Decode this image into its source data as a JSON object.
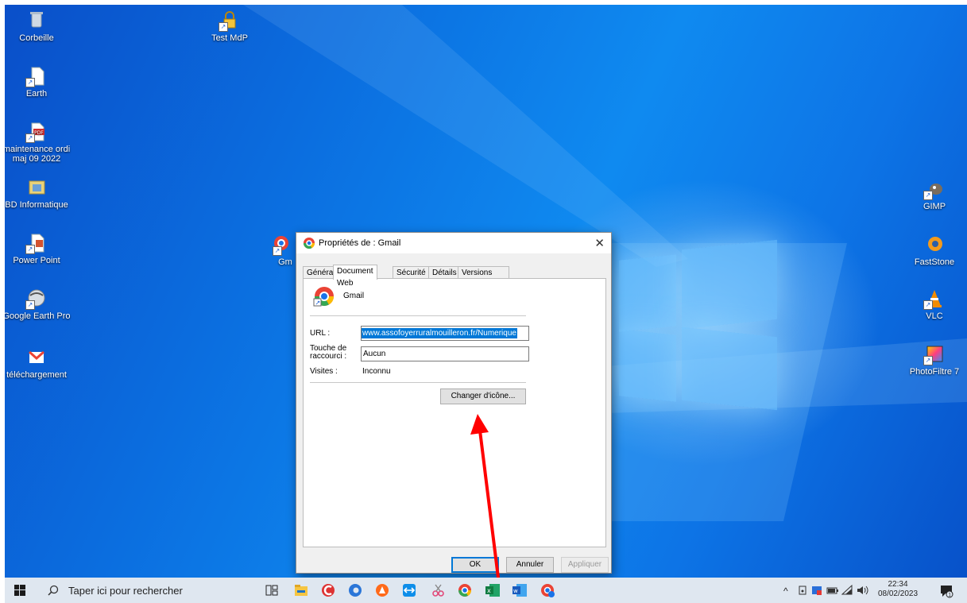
{
  "desktop": {
    "icons_left": [
      {
        "label": "Corbeille",
        "icon": "recycle-bin-icon"
      },
      {
        "label": "Earth",
        "icon": "file-shortcut-icon"
      },
      {
        "label": "maintenance ordi maj 09 2022",
        "icon": "pdf-file-icon"
      },
      {
        "label": "BD Informatique",
        "icon": "database-folder-icon"
      },
      {
        "label": "Power Point",
        "icon": "powerpoint-icon"
      },
      {
        "label": "Google Earth Pro",
        "icon": "google-earth-icon"
      },
      {
        "label": "téléchargement",
        "icon": "gmail-icon"
      }
    ],
    "icon_test": {
      "label": "Test MdP",
      "icon": "lock-icon"
    },
    "icon_partial": {
      "label": "Gm",
      "icon": "chrome-shortcut-icon"
    },
    "icons_right": [
      {
        "label": "GIMP",
        "icon": "gimp-icon"
      },
      {
        "label": "FastStone",
        "icon": "faststone-icon"
      },
      {
        "label": "VLC",
        "icon": "vlc-icon"
      },
      {
        "label": "PhotoFiltre 7",
        "icon": "photofiltre-icon"
      }
    ]
  },
  "dialog": {
    "title": "Propriétés de : Gmail",
    "close": "✕",
    "tabs": [
      "Général",
      "Document Web",
      "Sécurité",
      "Détails",
      "Versions précédentes"
    ],
    "active_tab": "Document Web",
    "name": "Gmail",
    "url_label": "URL :",
    "url_value": "www.assofoyerruralmouilleron.fr/Numerique",
    "shortcut_label_1": "Touche de",
    "shortcut_label_2": "raccourci :",
    "shortcut_value": "Aucun",
    "visits_label": "Visites :",
    "visits_value": "Inconnu",
    "change_icon_button": "Changer d'icône...",
    "ok_button": "OK",
    "cancel_button": "Annuler",
    "apply_button": "Appliquer"
  },
  "taskbar": {
    "search_placeholder": "Taper ici pour rechercher",
    "time": "22:34",
    "date": "08/02/2023"
  },
  "colors": {
    "desktop_blue": "#0b6fe0",
    "taskbar_bg": "#dfe7f0",
    "url_selection": "#0078d7",
    "annotation_arrow": "#ff0000"
  }
}
